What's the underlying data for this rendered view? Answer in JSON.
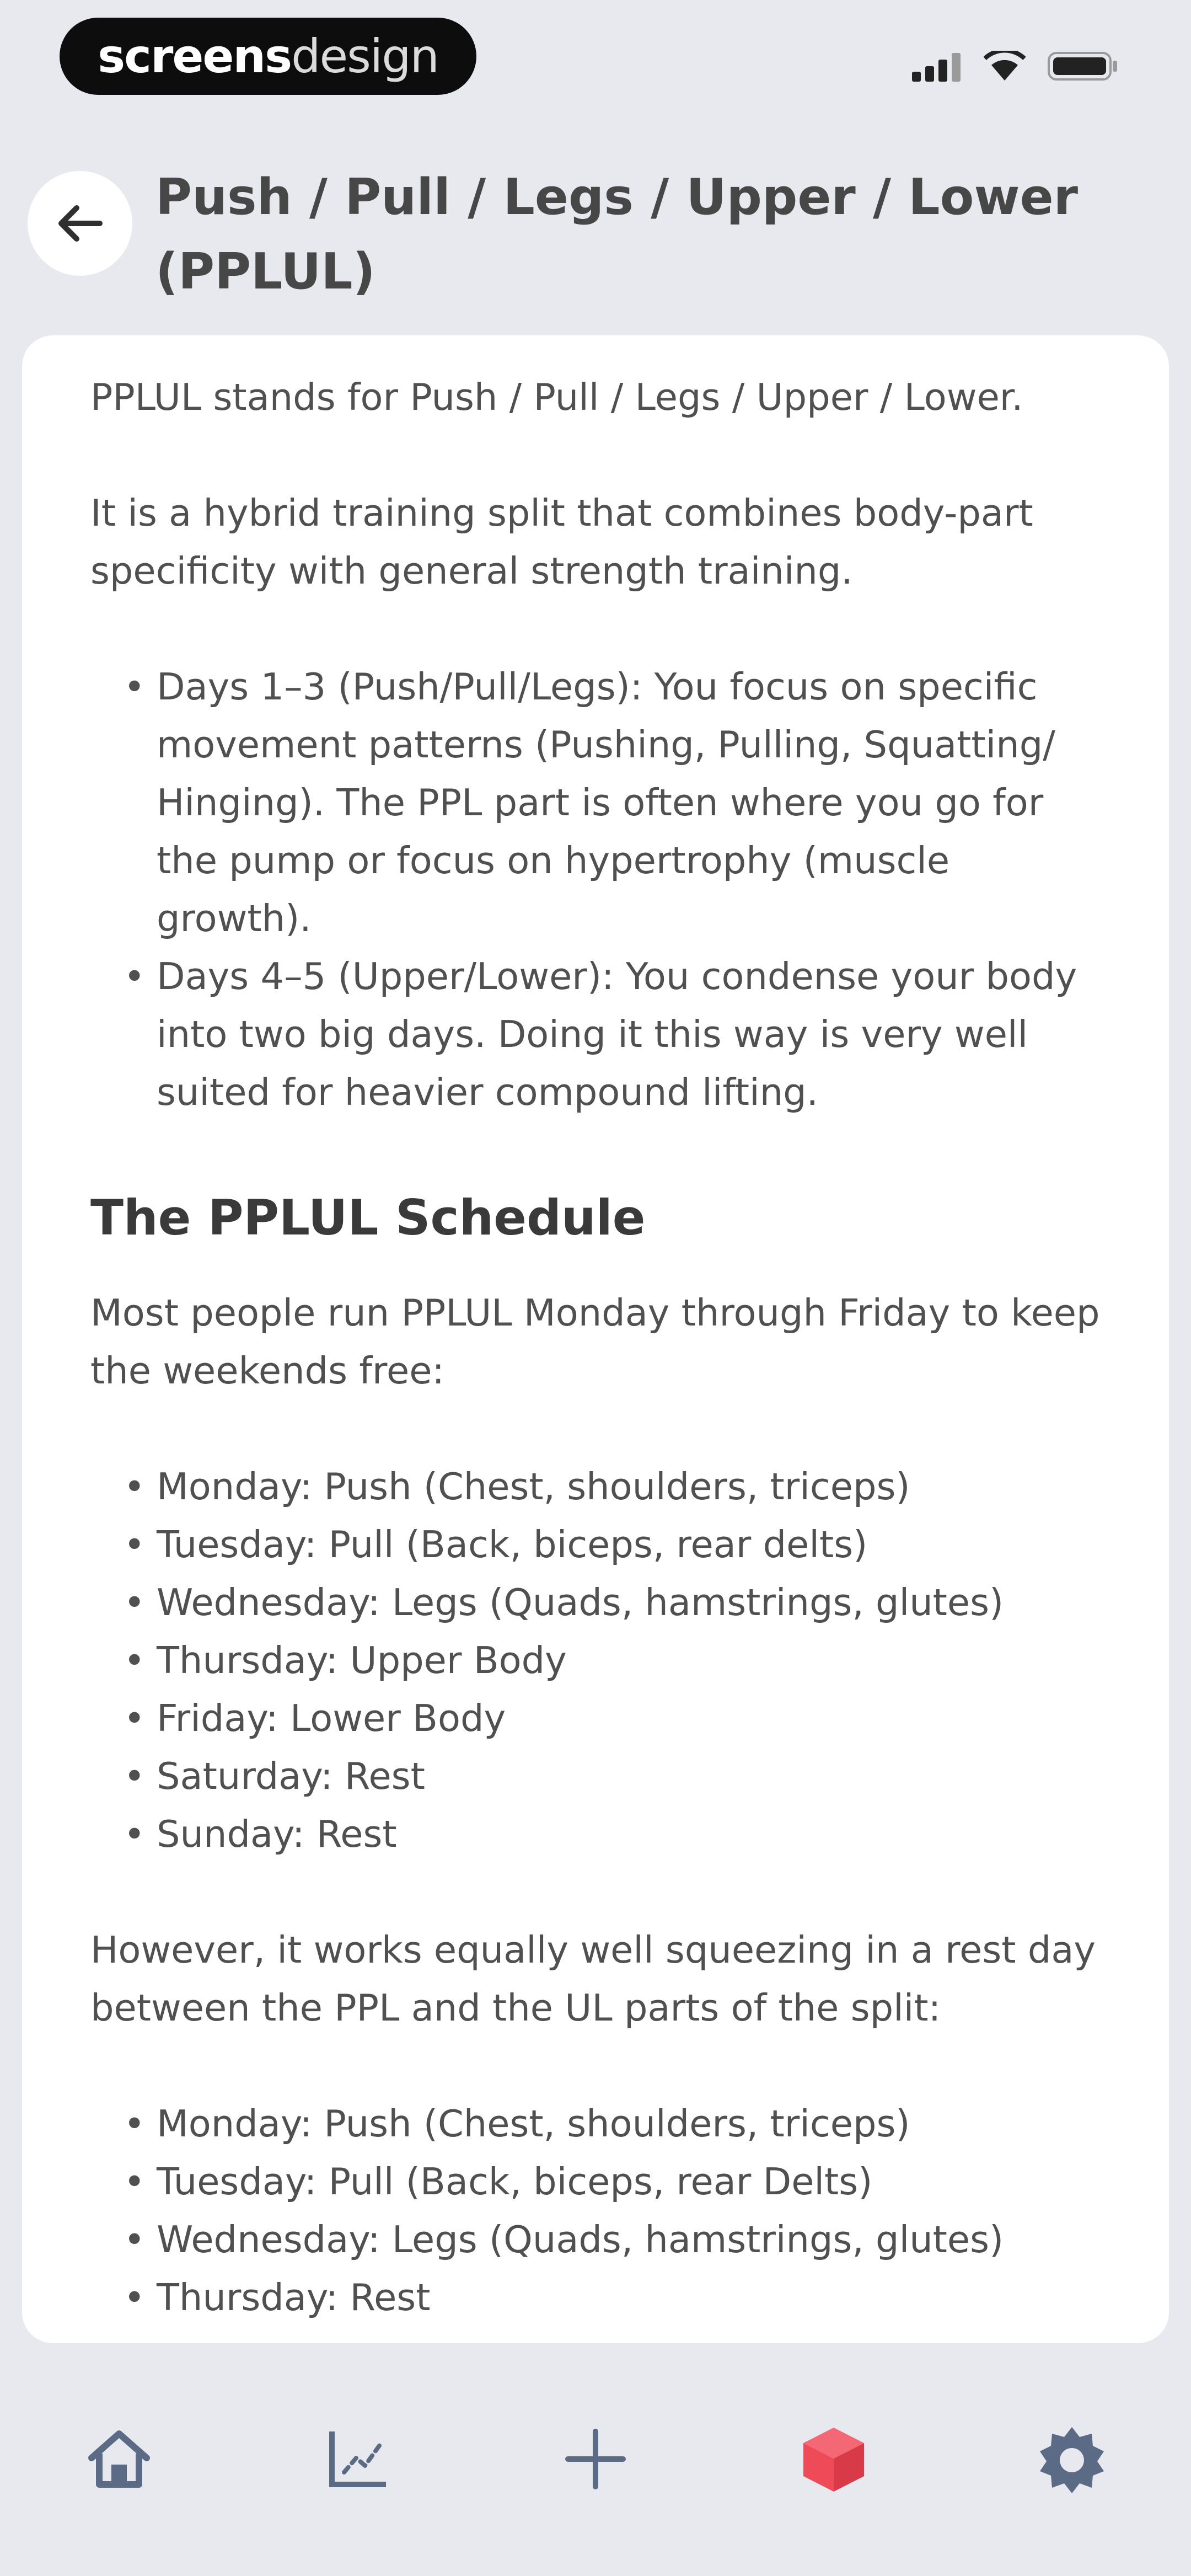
{
  "status_bar": {
    "brand_bold": "screens",
    "brand_light": "design",
    "icons": [
      "signal-icon",
      "wifi-icon",
      "battery-icon"
    ]
  },
  "header": {
    "back_icon": "arrow-left-icon",
    "title": "Push / Pull / Legs / Upper / Lower (PPLUL)"
  },
  "article": {
    "intro": "PPLUL stands for Push / Pull / Legs / Upper / Lower.",
    "description": "It is a hybrid training split that combines body-part specificity with general strength training.",
    "days_bullets": [
      "Days 1–3 (Push/Pull/Legs): You focus on specific movement patterns (Pushing, Pulling, Squatting/ Hinging). The PPL part is often where you go for the pump or focus on hypertrophy (muscle growth).",
      "Days 4–5 (Upper/Lower): You condense your body into two big days. Doing it this way is very well suited for heavier compound lifting."
    ],
    "schedule_heading": "The PPLUL Schedule",
    "schedule_intro": "Most people run PPLUL Monday through Friday to keep the weekends free:",
    "schedule_1": [
      "Monday: Push (Chest, shoulders, triceps)",
      "Tuesday: Pull (Back, biceps, rear delts)",
      "Wednesday: Legs (Quads, hamstrings, glutes)",
      "Thursday: Upper Body",
      "Friday: Lower Body",
      "Saturday: Rest",
      "Sunday: Rest"
    ],
    "alt_intro": "However, it works equally well squeezing in a rest day between the PPL and the UL parts of the split:",
    "schedule_2": [
      "Monday: Push (Chest, shoulders, triceps)",
      "Tuesday: Pull (Back, biceps, rear Delts)",
      "Wednesday: Legs (Quads, hamstrings, glutes)",
      "Thursday: Rest"
    ]
  },
  "tab_bar": {
    "tabs": [
      {
        "icon": "home-icon",
        "active": false
      },
      {
        "icon": "chart-icon",
        "active": false
      },
      {
        "icon": "plus-icon",
        "active": false
      },
      {
        "icon": "cube-icon",
        "active": true
      },
      {
        "icon": "gear-icon",
        "active": false
      }
    ],
    "active_color": "#ef4a57",
    "inactive_color": "#5b6b86"
  }
}
